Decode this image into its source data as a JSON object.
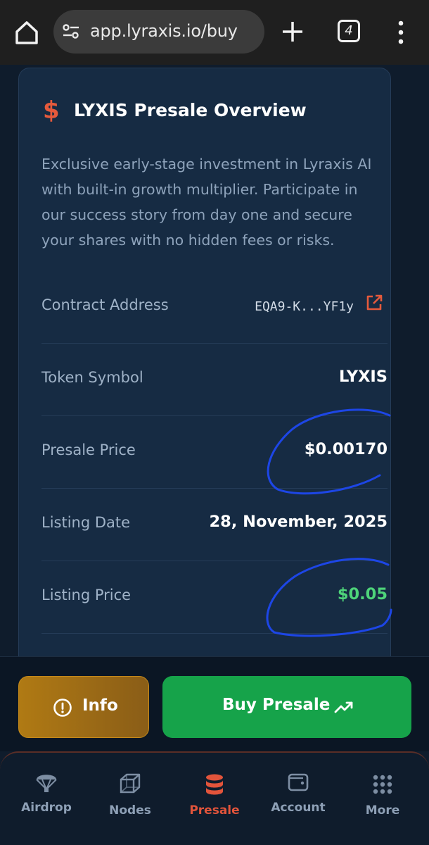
{
  "browser": {
    "url": "app.lyraxis.io/buy",
    "tab_count": "4"
  },
  "card": {
    "title": "LYXIS Presale Overview",
    "description": "Exclusive early-stage investment in Lyraxis AI with built-in growth multiplier. Participate in our success story from day one and secure your shares with no hidden fees or risks.",
    "rows": [
      {
        "label": "Contract Address",
        "value": "EQA9-K...YF1y"
      },
      {
        "label": "Token Symbol",
        "value": "LYXIS"
      },
      {
        "label": "Presale Price",
        "value": "$0.00170"
      },
      {
        "label": "Listing Date",
        "value": "28, November, 2025"
      },
      {
        "label": "Listing Price",
        "value": "$0.05"
      }
    ]
  },
  "actions": {
    "info_label": "Info",
    "buy_label": "Buy Presale"
  },
  "nav": {
    "items": [
      {
        "label": "Airdrop",
        "icon": "parachute-icon"
      },
      {
        "label": "Nodes",
        "icon": "cube-icon"
      },
      {
        "label": "Presale",
        "icon": "database-icon",
        "active": true
      },
      {
        "label": "Account",
        "icon": "wallet-icon"
      },
      {
        "label": "More",
        "icon": "grid-dots-icon"
      }
    ]
  },
  "colors": {
    "accent": "#e55a3c",
    "success": "#16a34a",
    "warning": "#b07a14",
    "background": "#0f1c2c",
    "card": "#162b43"
  }
}
